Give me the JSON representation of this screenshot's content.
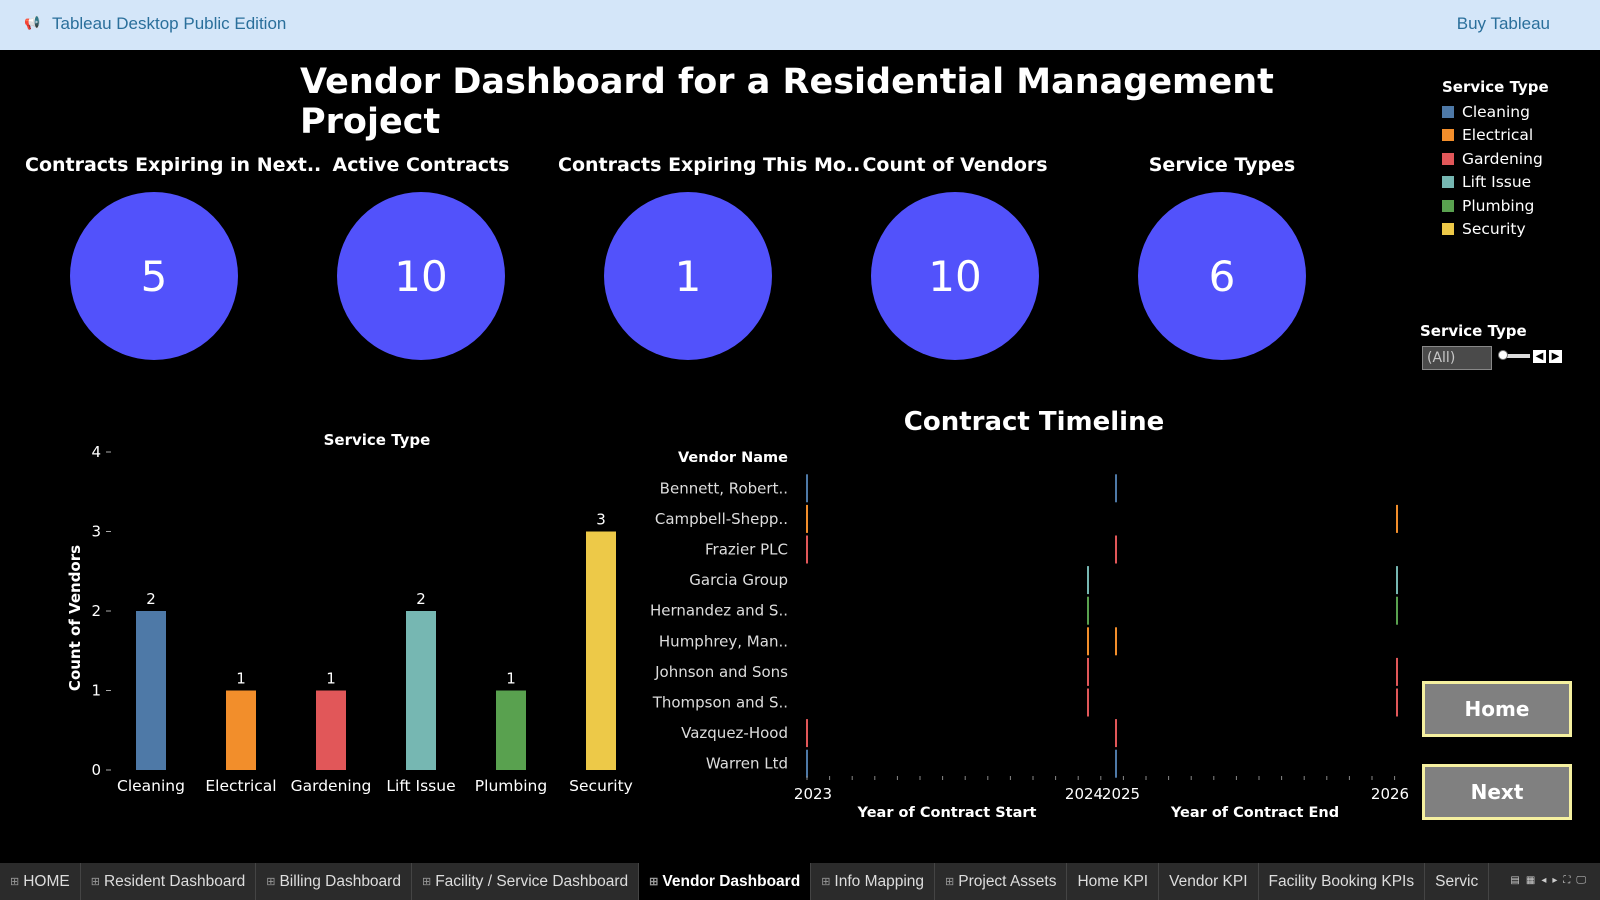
{
  "topbar": {
    "app_title": "Tableau Desktop Public Edition",
    "buy_label": "Buy Tableau"
  },
  "dashboard_title": "Vendor Dashboard for a Residential Management Project",
  "kpis": [
    {
      "label": "Contracts Expiring in Next..",
      "value": "5"
    },
    {
      "label": "Active Contracts",
      "value": "10"
    },
    {
      "label": "Contracts Expiring This Mo..",
      "value": "1"
    },
    {
      "label": "Count of Vendors",
      "value": "10"
    },
    {
      "label": "Service Types",
      "value": "6"
    }
  ],
  "legend": {
    "title": "Service Type",
    "items": [
      {
        "label": "Cleaning",
        "color": "#4e79a7"
      },
      {
        "label": "Electrical",
        "color": "#f28e2b"
      },
      {
        "label": "Gardening",
        "color": "#e15759"
      },
      {
        "label": "Lift Issue",
        "color": "#76b7b2"
      },
      {
        "label": "Plumbing",
        "color": "#59a14f"
      },
      {
        "label": "Security",
        "color": "#edc948"
      }
    ]
  },
  "filter": {
    "title": "Service Type",
    "value": "(All)"
  },
  "buttons": {
    "home": "Home",
    "next": "Next"
  },
  "chart_data": [
    {
      "type": "bar",
      "title": "Service Type",
      "xlabel": "",
      "ylabel": "Count of Vendors",
      "categories": [
        "Cleaning",
        "Electrical",
        "Gardening",
        "Lift Issue",
        "Plumbing",
        "Security"
      ],
      "values": [
        2,
        1,
        1,
        2,
        1,
        3
      ],
      "colors": [
        "#4e79a7",
        "#f28e2b",
        "#e15759",
        "#76b7b2",
        "#59a14f",
        "#edc948"
      ],
      "ylim": [
        0,
        4
      ],
      "yticks": [
        0,
        1,
        2,
        3,
        4
      ],
      "grid": false
    },
    {
      "type": "scatter",
      "title": "Contract Timeline",
      "row_header": "Vendor Name",
      "xlabel_start": "Year of Contract Start",
      "xlabel_end": "Year of Contract End",
      "x_ticks_start": [
        "2023",
        "2024"
      ],
      "x_ticks_end": [
        "2025",
        "2026"
      ],
      "vendors": [
        "Bennett, Robert..",
        "Campbell-Shepp..",
        "Frazier PLC",
        "Garcia Group",
        "Hernandez and S..",
        "Humphrey, Man..",
        "Johnson and Sons",
        "Thompson and S..",
        "Vazquez-Hood",
        "Warren Ltd"
      ],
      "service_types": [
        "Cleaning",
        "Electrical",
        "Gardening",
        "Lift Issue",
        "Plumbing",
        "Electrical",
        "Gardening",
        "Gardening",
        "Gardening",
        "Cleaning"
      ],
      "start_year": [
        2023,
        2023,
        2023,
        2024,
        2024,
        2024,
        2024,
        2024,
        2023,
        2023
      ],
      "end_year": [
        2025,
        2026,
        2025,
        2026,
        2026,
        2025,
        2026,
        2026,
        2025,
        2025
      ]
    }
  ],
  "tabs": [
    {
      "label": "HOME",
      "active": false
    },
    {
      "label": "Resident Dashboard",
      "active": false
    },
    {
      "label": "Billing Dashboard",
      "active": false
    },
    {
      "label": "Facility / Service Dashboard",
      "active": false
    },
    {
      "label": "Vendor Dashboard",
      "active": true
    },
    {
      "label": "Info Mapping",
      "active": false
    },
    {
      "label": "Project Assets",
      "active": false
    },
    {
      "label": "Home KPI",
      "active": false
    },
    {
      "label": "Vendor KPI",
      "active": false
    },
    {
      "label": "Facility Booking KPIs",
      "active": false
    },
    {
      "label": "Servic",
      "active": false
    }
  ]
}
